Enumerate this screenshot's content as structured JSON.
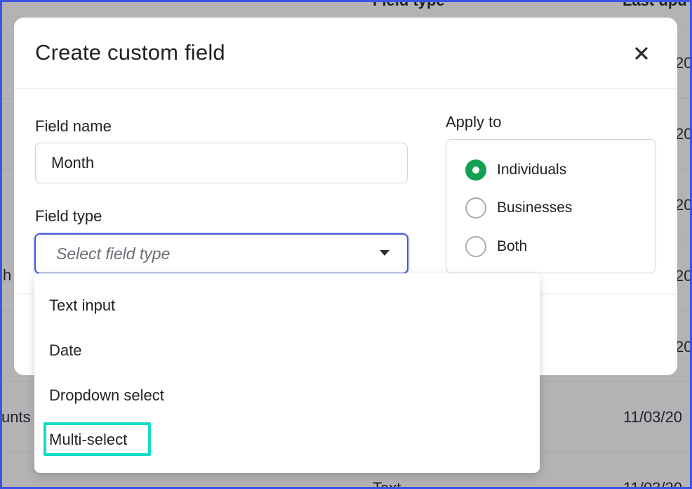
{
  "background_table": {
    "header_field_type": "Field type",
    "header_last_updated": "Last upd",
    "row_fragments": [
      "20",
      "20",
      "20",
      "h",
      "20",
      "20",
      "unts",
      "11/03/20",
      "Text",
      "11/03/20"
    ]
  },
  "modal": {
    "title": "Create custom field",
    "close_icon": "close-icon",
    "field_name_label": "Field name",
    "field_name_value": "Month",
    "field_type_label": "Field type",
    "field_type_placeholder": "Select field type",
    "caret_icon": "caret-down-icon",
    "apply_to_label": "Apply to",
    "apply_to_options": [
      {
        "label": "Individuals",
        "checked": true
      },
      {
        "label": "Businesses",
        "checked": false
      },
      {
        "label": "Both",
        "checked": false
      }
    ],
    "accent_color": "#12a052",
    "focus_color": "#4456d8"
  },
  "dropdown_menu": {
    "items": [
      "Text input",
      "Date",
      "Dropdown select",
      "Multi-select"
    ],
    "highlighted_item": "Multi-select",
    "highlight_color": "#14dcc4"
  }
}
